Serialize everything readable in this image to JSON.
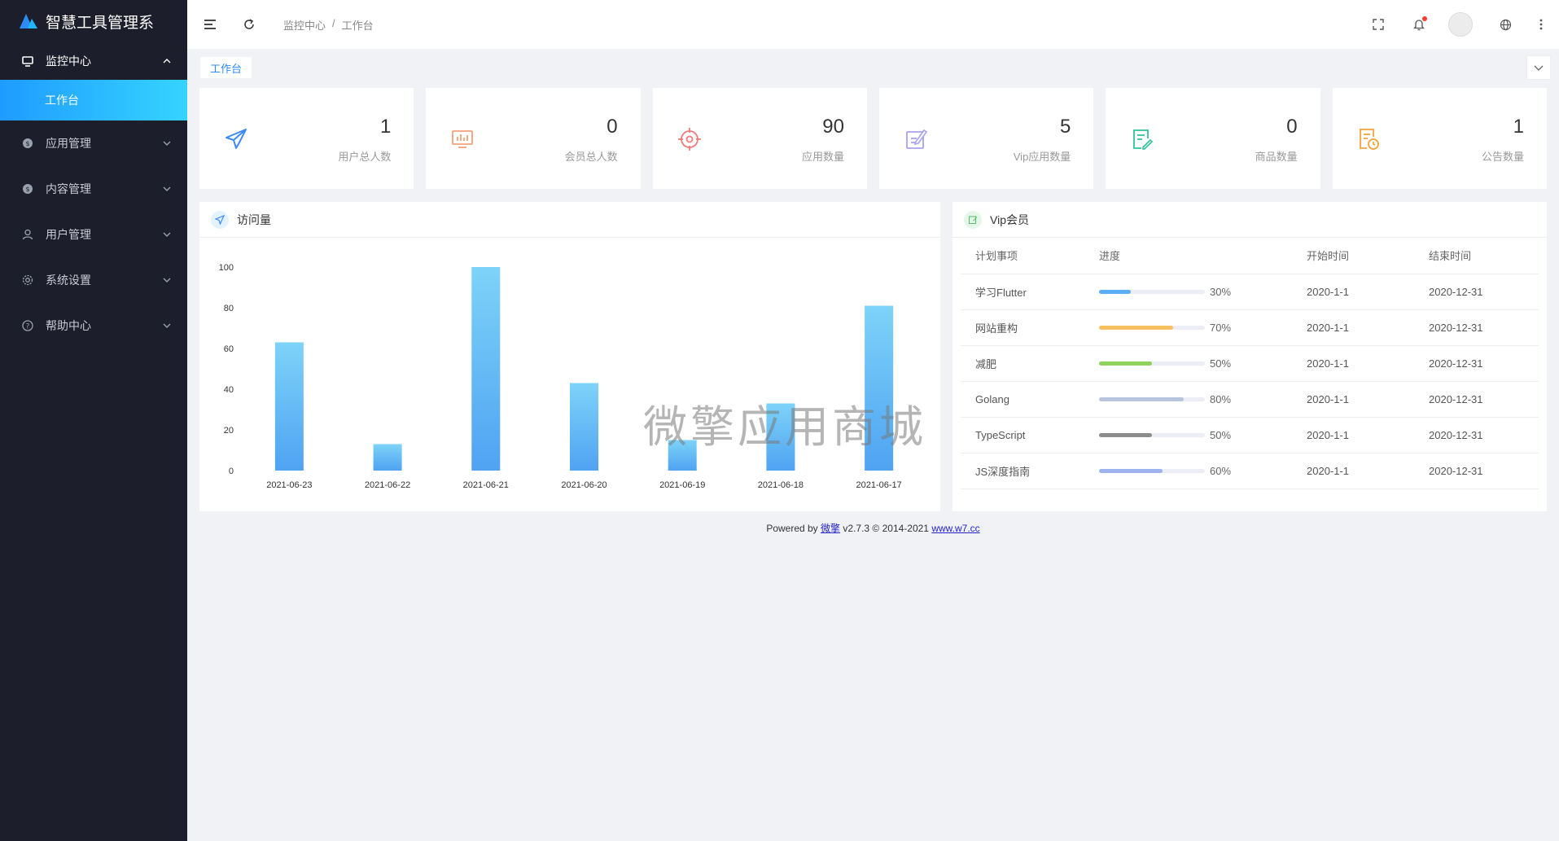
{
  "app": {
    "title": "智慧工具管理系"
  },
  "sidebar": {
    "items": [
      {
        "label": "监控中心",
        "icon": "monitor-icon",
        "open": true,
        "children": [
          {
            "label": "工作台",
            "active": true
          }
        ]
      },
      {
        "label": "应用管理",
        "icon": "coin-icon"
      },
      {
        "label": "内容管理",
        "icon": "coin-icon"
      },
      {
        "label": "用户管理",
        "icon": "user-icon"
      },
      {
        "label": "系统设置",
        "icon": "gear-icon"
      },
      {
        "label": "帮助中心",
        "icon": "help-icon"
      }
    ]
  },
  "topbar": {
    "breadcrumb": [
      "监控中心",
      "/",
      "工作台"
    ]
  },
  "tabs": {
    "active": "工作台"
  },
  "stats": [
    {
      "value": "1",
      "label": "用户总人数",
      "icon": "paper-plane-icon",
      "color": "#3d8af7"
    },
    {
      "value": "0",
      "label": "会员总人数",
      "icon": "chart-board-icon",
      "color": "#f4a07a"
    },
    {
      "value": "90",
      "label": "应用数量",
      "icon": "target-icon",
      "color": "#f27b7b"
    },
    {
      "value": "5",
      "label": "Vip应用数量",
      "icon": "edit-note-icon",
      "color": "#a9a2f0"
    },
    {
      "value": "0",
      "label": "商品数量",
      "icon": "document-edit-icon",
      "color": "#2fc29b"
    },
    {
      "value": "1",
      "label": "公告数量",
      "icon": "document-clock-icon",
      "color": "#f5a23b"
    }
  ],
  "visits_panel": {
    "title": "访问量"
  },
  "chart_data": {
    "type": "bar",
    "categories": [
      "2021-06-23",
      "2021-06-22",
      "2021-06-21",
      "2021-06-20",
      "2021-06-19",
      "2021-06-18",
      "2021-06-17"
    ],
    "values": [
      63,
      13,
      100,
      43,
      15,
      33,
      81
    ],
    "ylim": [
      0,
      100
    ],
    "yticks": [
      "0",
      "20",
      "40",
      "60",
      "80",
      "100"
    ],
    "title": "",
    "xlabel": "",
    "ylabel": "",
    "bar_color_top": "#7dd3f8",
    "bar_color_bottom": "#4fa3f2"
  },
  "vip_panel": {
    "title": "Vip会员",
    "columns": [
      "计划事项",
      "进度",
      "开始时间",
      "结束时间"
    ],
    "rows": [
      {
        "name": "学习Flutter",
        "progress": 30,
        "progress_text": "30%",
        "color": "#5aaef5",
        "start": "2020-1-1",
        "end": "2020-12-31"
      },
      {
        "name": "网站重构",
        "progress": 70,
        "progress_text": "70%",
        "color": "#f7c061",
        "start": "2020-1-1",
        "end": "2020-12-31"
      },
      {
        "name": "减肥",
        "progress": 50,
        "progress_text": "50%",
        "color": "#8fd35e",
        "start": "2020-1-1",
        "end": "2020-12-31"
      },
      {
        "name": "Golang",
        "progress": 80,
        "progress_text": "80%",
        "color": "#b7c6de",
        "start": "2020-1-1",
        "end": "2020-12-31"
      },
      {
        "name": "TypeScript",
        "progress": 50,
        "progress_text": "50%",
        "color": "#8c8c8c",
        "start": "2020-1-1",
        "end": "2020-12-31"
      },
      {
        "name": "JS深度指南",
        "progress": 60,
        "progress_text": "60%",
        "color": "#9cb3ee",
        "start": "2020-1-1",
        "end": "2020-12-31"
      }
    ]
  },
  "watermark": "微擎应用商城",
  "footer": {
    "powered": "Powered by",
    "brand": "微擎",
    "version": "v2.7.3 © 2014-2021",
    "link": "www.w7.cc"
  }
}
